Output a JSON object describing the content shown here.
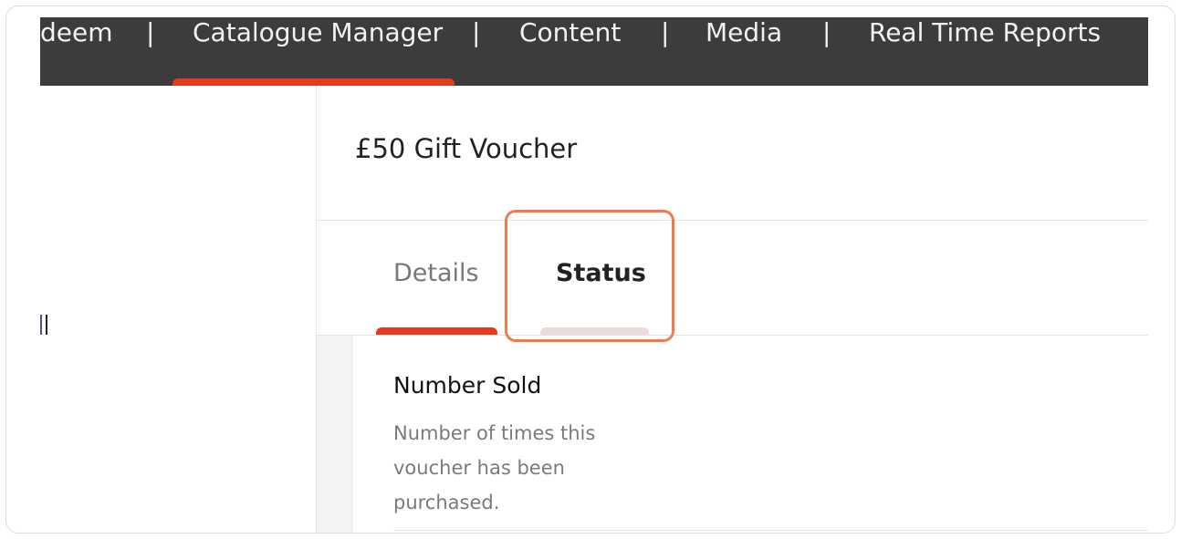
{
  "nav": {
    "items": [
      {
        "label": "deem"
      },
      {
        "label": "Catalogue Manager"
      },
      {
        "label": "Content"
      },
      {
        "label": "Media"
      },
      {
        "label": "Real Time Reports"
      }
    ],
    "separator": "|"
  },
  "page": {
    "title": "£50 Gift Voucher"
  },
  "tabs": [
    {
      "label": "Details",
      "active": true
    },
    {
      "label": "Status",
      "active": false
    }
  ],
  "section": {
    "title": "Number Sold",
    "description": "Number of times this voucher has been purchased."
  },
  "colors": {
    "nav_bg": "#3c3c3c",
    "accent": "#e63a1e",
    "highlight": "#f5794e"
  }
}
